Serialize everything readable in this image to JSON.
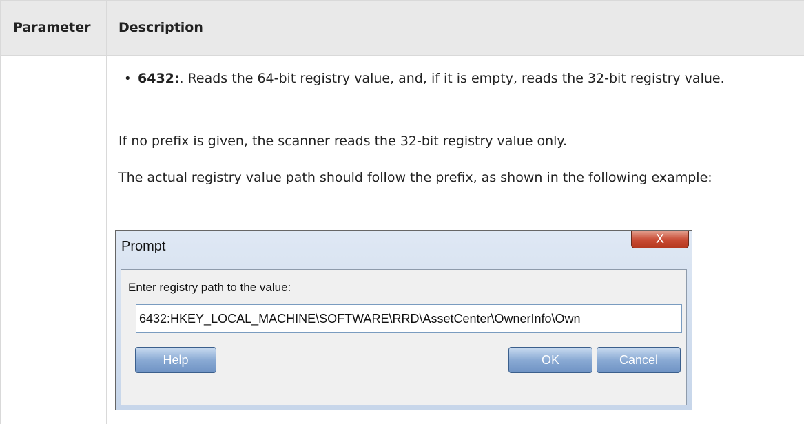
{
  "table": {
    "headers": {
      "parameter": "Parameter",
      "description": "Description"
    },
    "bullet": {
      "term": "6432:",
      "text": ". Reads the 64-bit registry value, and, if it is empty, reads the 32-bit registry value."
    },
    "paragraph1": "If no prefix is given, the scanner reads the 32-bit registry value only.",
    "paragraph2": "The actual registry value path should follow the prefix, as shown in the following example:"
  },
  "dialog": {
    "title": "Prompt",
    "close_label": "X",
    "prompt_label": "Enter registry path to the value:",
    "path_value": "6432:HKEY_LOCAL_MACHINE\\SOFTWARE\\RRD\\AssetCenter\\OwnerInfo\\Own",
    "buttons": {
      "help": {
        "mnemonic": "H",
        "rest": "elp"
      },
      "ok": {
        "mnemonic": "O",
        "rest": "K"
      },
      "cancel": "Cancel"
    }
  }
}
